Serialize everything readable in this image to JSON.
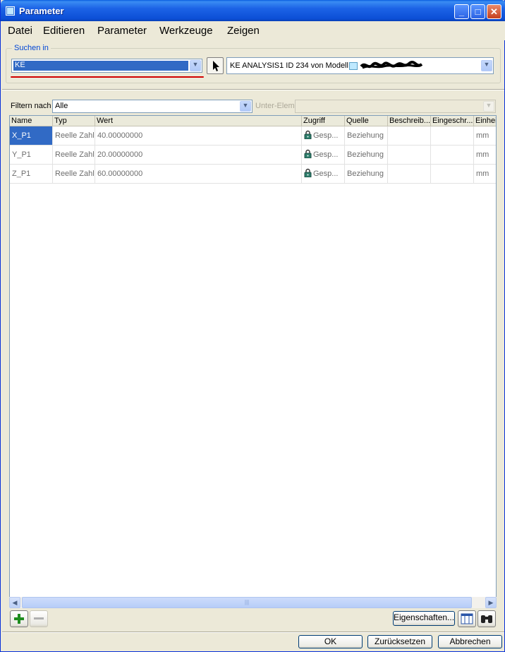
{
  "window": {
    "title": "Parameter"
  },
  "menu": [
    "Datei",
    "Editieren",
    "Parameter",
    "Werkzeuge",
    "Zeigen"
  ],
  "search": {
    "group_label": "Suchen in",
    "scope_value": "KE",
    "model_value": "KE ANALYSIS1 ID 234 von Modell"
  },
  "filter": {
    "label": "Filtern nach",
    "value": "Alle",
    "sub_label": "Unter-Elem",
    "sub_value": ""
  },
  "table": {
    "columns": [
      "Name",
      "Typ",
      "Wert",
      "Zugriff",
      "Quelle",
      "Beschreib...",
      "Eingeschr...",
      "Einheit"
    ],
    "rows": [
      {
        "name": "X_P1",
        "typ": "Reelle Zahl",
        "wert": "40.00000000",
        "zugriff": "Gesp...",
        "quelle": "Beziehung",
        "beschreib": "",
        "eingeschr": "",
        "einheit": "mm"
      },
      {
        "name": "Y_P1",
        "typ": "Reelle Zahl",
        "wert": "20.00000000",
        "zugriff": "Gesp...",
        "quelle": "Beziehung",
        "beschreib": "",
        "eingeschr": "",
        "einheit": "mm"
      },
      {
        "name": "Z_P1",
        "typ": "Reelle Zahl",
        "wert": "60.00000000",
        "zugriff": "Gesp...",
        "quelle": "Beziehung",
        "beschreib": "",
        "eingeschr": "",
        "einheit": "mm"
      }
    ]
  },
  "buttons": {
    "eigenschaften": "Eigenschaften...",
    "ok": "OK",
    "reset": "Zurücksetzen",
    "cancel": "Abbrechen"
  },
  "colors": {
    "accent": "#316ac5",
    "title_bar": "#0c4fd6",
    "highlight_line": "#d00000"
  }
}
